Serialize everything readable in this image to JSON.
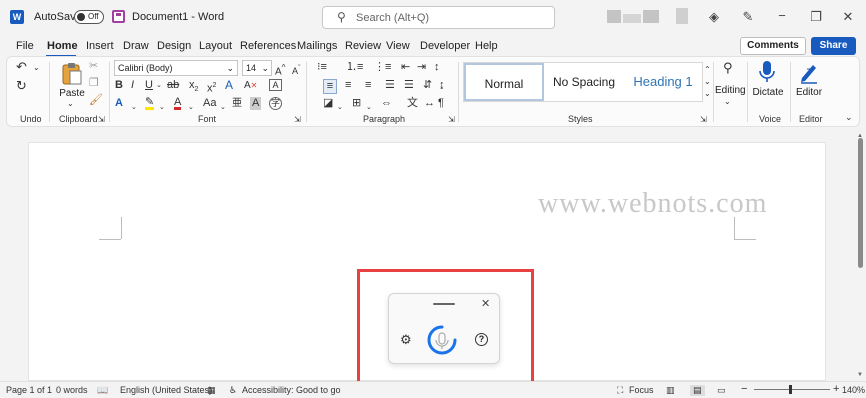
{
  "titlebar": {
    "app_icon": "W",
    "autosave_label": "AutoSave",
    "autosave_state": "Off",
    "document_title": "Document1  -  Word",
    "search_placeholder": "Search (Alt+Q)",
    "icons": [
      "diamond-icon",
      "pen-icon",
      "minimize-icon",
      "restore-icon",
      "close-icon"
    ]
  },
  "tabs": [
    "File",
    "Home",
    "Insert",
    "Draw",
    "Design",
    "Layout",
    "References",
    "Mailings",
    "Review",
    "View",
    "Developer",
    "Help"
  ],
  "active_tab": "Home",
  "actions": {
    "comments": "Comments",
    "share": "Share"
  },
  "ribbon": {
    "groups": {
      "undo": "Undo",
      "clipboard": "Clipboard",
      "font": "Font",
      "paragraph": "Paragraph",
      "styles": "Styles",
      "voice": "Voice",
      "editor": "Editor"
    },
    "paste_label": "Paste",
    "font_name": "Calibri (Body)",
    "font_size": "14",
    "styles": [
      "Normal",
      "No Spacing",
      "Heading 1"
    ],
    "selected_style": "Normal",
    "editing_label": "Editing",
    "dictate_label": "Dictate",
    "editor_label": "Editor"
  },
  "document": {
    "watermark": "www.webnots.com"
  },
  "dictation_toolbar": {
    "icons": [
      "settings-icon",
      "microphone-icon",
      "help-icon",
      "close-icon"
    ]
  },
  "statusbar": {
    "page": "Page 1 of 1",
    "words": "0 words",
    "language": "English (United States)",
    "accessibility": "Accessibility: Good to go",
    "focus": "Focus",
    "zoom": "140%"
  },
  "colors": {
    "accent": "#185abd",
    "highlight_border": "#e84141",
    "dictate_spinner": "#1a73e8"
  }
}
